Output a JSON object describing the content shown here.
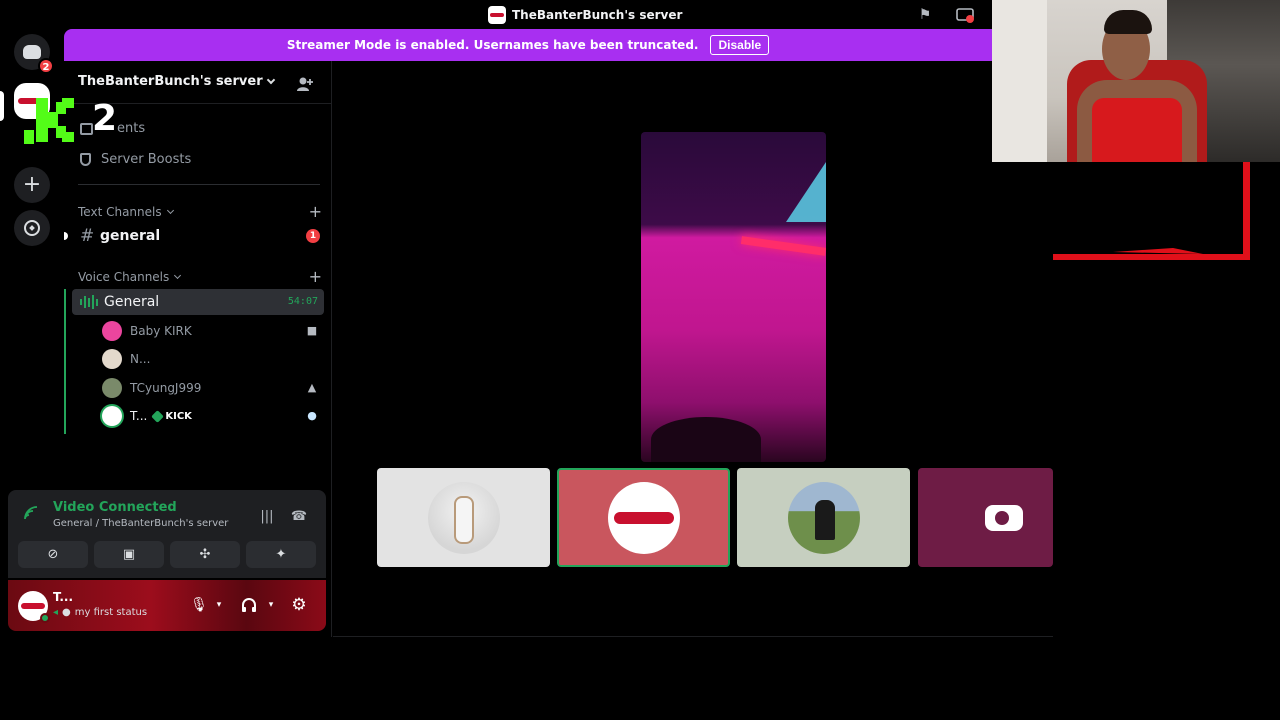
{
  "titlebar": {
    "title": "TheBanterBunch's server"
  },
  "rail": {
    "home_badge": "2"
  },
  "overlay": {
    "kick_number": "2"
  },
  "banner": {
    "text": "Streamer Mode is enabled. Usernames have been truncated.",
    "button": "Disable"
  },
  "sidebar": {
    "server_name": "TheBanterBunch's server",
    "events_label": "Events",
    "events_visible": "ents",
    "boosts_label": "Server Boosts",
    "text_category": "Text Channels",
    "voice_category": "Voice Channels",
    "text_channel": {
      "name": "general",
      "mentions": "1"
    },
    "voice_channel": {
      "name": "General",
      "timer": "54:07"
    },
    "members": [
      {
        "name": "Baby KIRK"
      },
      {
        "name": "N..."
      },
      {
        "name": "TCyungJ999"
      },
      {
        "name": "T...",
        "tag": "KICK"
      }
    ]
  },
  "voice_panel": {
    "title": "Video Connected",
    "subtitle": "General / TheBanterBunch's server"
  },
  "user_panel": {
    "name": "T...",
    "status": "my first status"
  },
  "colors": {
    "accent": "#a82ff1",
    "voice_green": "#23a55a",
    "badge_red": "#f23f43",
    "kick_green": "#53fc18"
  }
}
